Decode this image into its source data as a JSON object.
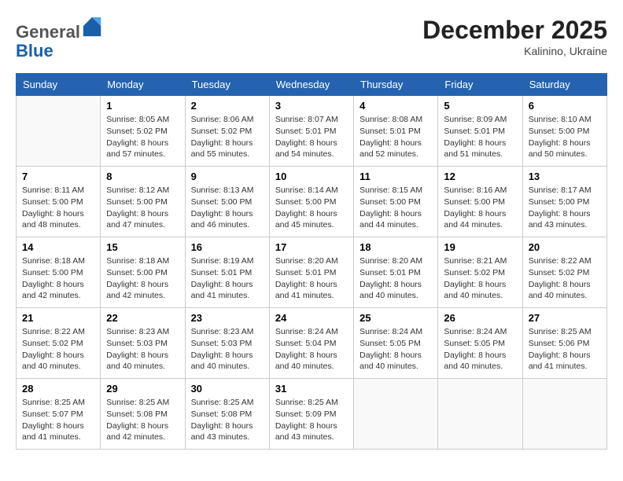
{
  "header": {
    "logo_general": "General",
    "logo_blue": "Blue",
    "month_title": "December 2025",
    "location": "Kalinino, Ukraine"
  },
  "weekdays": [
    "Sunday",
    "Monday",
    "Tuesday",
    "Wednesday",
    "Thursday",
    "Friday",
    "Saturday"
  ],
  "weeks": [
    [
      {
        "day": "",
        "info": ""
      },
      {
        "day": "1",
        "info": "Sunrise: 8:05 AM\nSunset: 5:02 PM\nDaylight: 8 hours\nand 57 minutes."
      },
      {
        "day": "2",
        "info": "Sunrise: 8:06 AM\nSunset: 5:02 PM\nDaylight: 8 hours\nand 55 minutes."
      },
      {
        "day": "3",
        "info": "Sunrise: 8:07 AM\nSunset: 5:01 PM\nDaylight: 8 hours\nand 54 minutes."
      },
      {
        "day": "4",
        "info": "Sunrise: 8:08 AM\nSunset: 5:01 PM\nDaylight: 8 hours\nand 52 minutes."
      },
      {
        "day": "5",
        "info": "Sunrise: 8:09 AM\nSunset: 5:01 PM\nDaylight: 8 hours\nand 51 minutes."
      },
      {
        "day": "6",
        "info": "Sunrise: 8:10 AM\nSunset: 5:00 PM\nDaylight: 8 hours\nand 50 minutes."
      }
    ],
    [
      {
        "day": "7",
        "info": "Sunrise: 8:11 AM\nSunset: 5:00 PM\nDaylight: 8 hours\nand 48 minutes."
      },
      {
        "day": "8",
        "info": "Sunrise: 8:12 AM\nSunset: 5:00 PM\nDaylight: 8 hours\nand 47 minutes."
      },
      {
        "day": "9",
        "info": "Sunrise: 8:13 AM\nSunset: 5:00 PM\nDaylight: 8 hours\nand 46 minutes."
      },
      {
        "day": "10",
        "info": "Sunrise: 8:14 AM\nSunset: 5:00 PM\nDaylight: 8 hours\nand 45 minutes."
      },
      {
        "day": "11",
        "info": "Sunrise: 8:15 AM\nSunset: 5:00 PM\nDaylight: 8 hours\nand 44 minutes."
      },
      {
        "day": "12",
        "info": "Sunrise: 8:16 AM\nSunset: 5:00 PM\nDaylight: 8 hours\nand 44 minutes."
      },
      {
        "day": "13",
        "info": "Sunrise: 8:17 AM\nSunset: 5:00 PM\nDaylight: 8 hours\nand 43 minutes."
      }
    ],
    [
      {
        "day": "14",
        "info": "Sunrise: 8:18 AM\nSunset: 5:00 PM\nDaylight: 8 hours\nand 42 minutes."
      },
      {
        "day": "15",
        "info": "Sunrise: 8:18 AM\nSunset: 5:00 PM\nDaylight: 8 hours\nand 42 minutes."
      },
      {
        "day": "16",
        "info": "Sunrise: 8:19 AM\nSunset: 5:01 PM\nDaylight: 8 hours\nand 41 minutes."
      },
      {
        "day": "17",
        "info": "Sunrise: 8:20 AM\nSunset: 5:01 PM\nDaylight: 8 hours\nand 41 minutes."
      },
      {
        "day": "18",
        "info": "Sunrise: 8:20 AM\nSunset: 5:01 PM\nDaylight: 8 hours\nand 40 minutes."
      },
      {
        "day": "19",
        "info": "Sunrise: 8:21 AM\nSunset: 5:02 PM\nDaylight: 8 hours\nand 40 minutes."
      },
      {
        "day": "20",
        "info": "Sunrise: 8:22 AM\nSunset: 5:02 PM\nDaylight: 8 hours\nand 40 minutes."
      }
    ],
    [
      {
        "day": "21",
        "info": "Sunrise: 8:22 AM\nSunset: 5:02 PM\nDaylight: 8 hours\nand 40 minutes."
      },
      {
        "day": "22",
        "info": "Sunrise: 8:23 AM\nSunset: 5:03 PM\nDaylight: 8 hours\nand 40 minutes."
      },
      {
        "day": "23",
        "info": "Sunrise: 8:23 AM\nSunset: 5:03 PM\nDaylight: 8 hours\nand 40 minutes."
      },
      {
        "day": "24",
        "info": "Sunrise: 8:24 AM\nSunset: 5:04 PM\nDaylight: 8 hours\nand 40 minutes."
      },
      {
        "day": "25",
        "info": "Sunrise: 8:24 AM\nSunset: 5:05 PM\nDaylight: 8 hours\nand 40 minutes."
      },
      {
        "day": "26",
        "info": "Sunrise: 8:24 AM\nSunset: 5:05 PM\nDaylight: 8 hours\nand 40 minutes."
      },
      {
        "day": "27",
        "info": "Sunrise: 8:25 AM\nSunset: 5:06 PM\nDaylight: 8 hours\nand 41 minutes."
      }
    ],
    [
      {
        "day": "28",
        "info": "Sunrise: 8:25 AM\nSunset: 5:07 PM\nDaylight: 8 hours\nand 41 minutes."
      },
      {
        "day": "29",
        "info": "Sunrise: 8:25 AM\nSunset: 5:08 PM\nDaylight: 8 hours\nand 42 minutes."
      },
      {
        "day": "30",
        "info": "Sunrise: 8:25 AM\nSunset: 5:08 PM\nDaylight: 8 hours\nand 43 minutes."
      },
      {
        "day": "31",
        "info": "Sunrise: 8:25 AM\nSunset: 5:09 PM\nDaylight: 8 hours\nand 43 minutes."
      },
      {
        "day": "",
        "info": ""
      },
      {
        "day": "",
        "info": ""
      },
      {
        "day": "",
        "info": ""
      }
    ]
  ]
}
